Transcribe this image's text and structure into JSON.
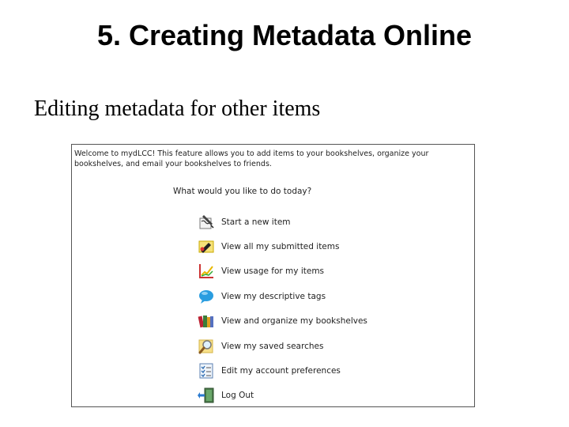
{
  "slide": {
    "title": "5. Creating Metadata Online",
    "subtitle": "Editing metadata for other items"
  },
  "screenshot": {
    "welcome_text": "Welcome to mydLCC! This feature allows you to add items to your bookshelves, organize your bookshelves, and email your bookshelves to friends.",
    "question": "What would you like to do today?",
    "menu": [
      {
        "label": "Start a new item",
        "icon": "pen-form-icon"
      },
      {
        "label": "View all my submitted items",
        "icon": "submitted-items-icon"
      },
      {
        "label": "View usage for my items",
        "icon": "usage-chart-icon"
      },
      {
        "label": "View my descriptive tags",
        "icon": "speech-bubble-icon"
      },
      {
        "label": "View and organize my bookshelves",
        "icon": "books-icon"
      },
      {
        "label": "View my saved searches",
        "icon": "magnifier-icon"
      },
      {
        "label": "Edit my account preferences",
        "icon": "checklist-icon"
      },
      {
        "label": "Log Out",
        "icon": "logout-door-icon"
      }
    ]
  }
}
